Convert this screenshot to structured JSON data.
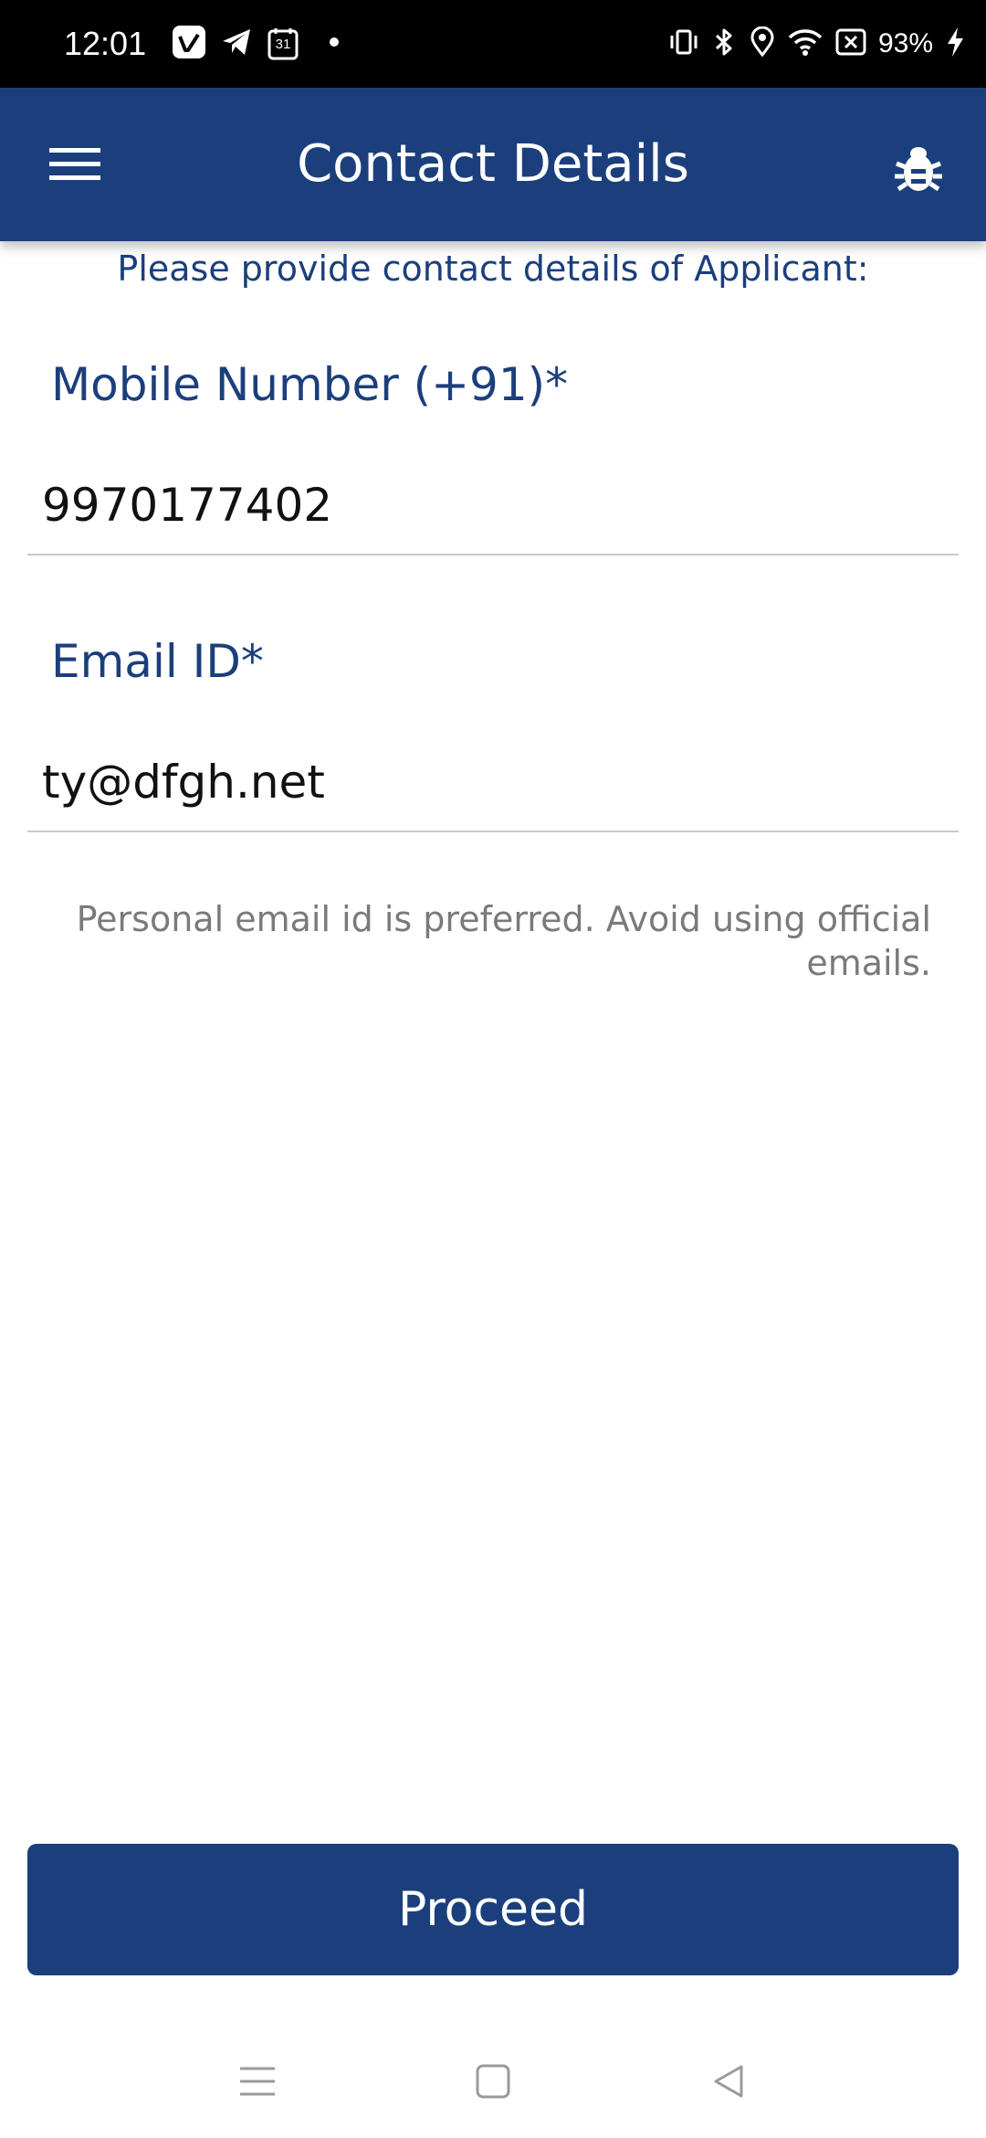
{
  "status_bar": {
    "time": "12:01",
    "battery": "93%",
    "left_icons": [
      "vimeo-icon",
      "telegram-icon",
      "calendar-icon",
      "dot-icon"
    ],
    "calendar_day": "31",
    "right_icons": [
      "vibrate-icon",
      "bluetooth-icon",
      "location-icon",
      "wifi-icon",
      "no-sim-icon",
      "charging-icon"
    ]
  },
  "app_bar": {
    "title": "Contact Details",
    "menu_icon": "hamburger-menu-icon",
    "action_icon": "bug-icon"
  },
  "form": {
    "instructions": "Please provide contact details of Applicant:",
    "mobile": {
      "label": "Mobile Number (+91)*",
      "value": "9970177402"
    },
    "email": {
      "label": "Email ID*",
      "value": "ty@dfgh.net"
    },
    "hint": "Personal email id is preferred. Avoid using official emails."
  },
  "actions": {
    "proceed_label": "Proceed"
  },
  "nav_bar": {
    "icons": [
      "recent-apps-icon",
      "home-icon",
      "back-icon"
    ]
  },
  "colors": {
    "primary": "#1b3f7c",
    "status_bar": "#000000",
    "hint_text": "#7a7a7a",
    "divider": "#c8c8c8"
  }
}
